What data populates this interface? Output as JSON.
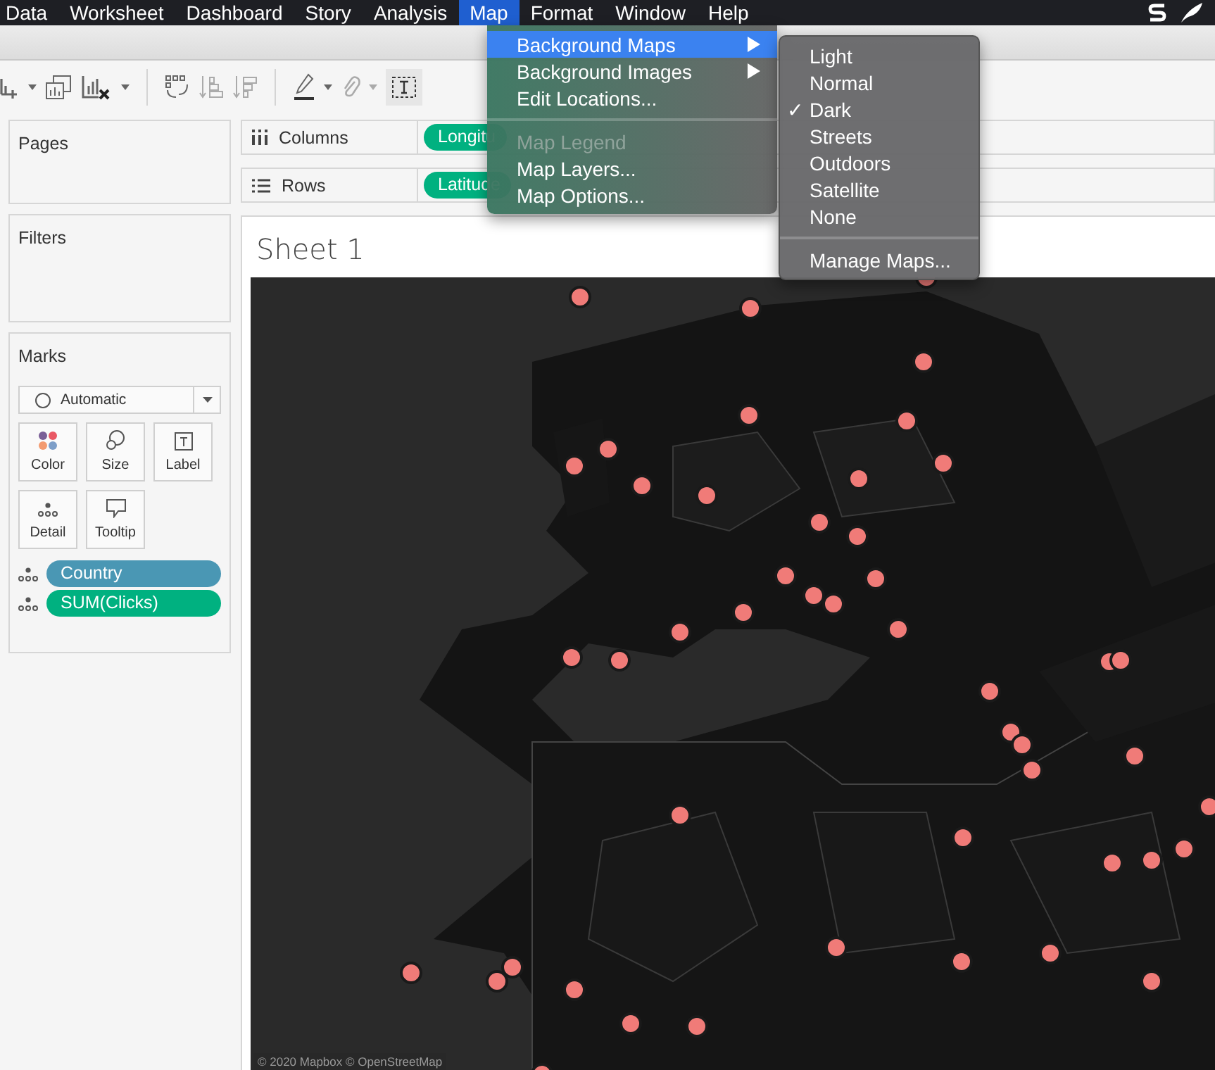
{
  "menubar": {
    "items": [
      {
        "label": "Data",
        "selected": false
      },
      {
        "label": "Worksheet",
        "selected": false
      },
      {
        "label": "Dashboard",
        "selected": false
      },
      {
        "label": "Story",
        "selected": false
      },
      {
        "label": "Analysis",
        "selected": false
      },
      {
        "label": "Map",
        "selected": true
      },
      {
        "label": "Format",
        "selected": false
      },
      {
        "label": "Window",
        "selected": false
      },
      {
        "label": "Help",
        "selected": false
      }
    ]
  },
  "map_menu": {
    "items": [
      {
        "kind": "item",
        "label": "Background Maps",
        "submenu": true,
        "disabled": false,
        "selected": true
      },
      {
        "kind": "item",
        "label": "Background Images",
        "submenu": true,
        "disabled": false,
        "selected": false
      },
      {
        "kind": "item",
        "label": "Edit Locations...",
        "submenu": false,
        "disabled": false,
        "selected": false
      },
      {
        "kind": "separator"
      },
      {
        "kind": "item",
        "label": "Map Legend",
        "submenu": false,
        "disabled": true,
        "selected": false
      },
      {
        "kind": "item",
        "label": "Map Layers...",
        "submenu": false,
        "disabled": false,
        "selected": false
      },
      {
        "kind": "item",
        "label": "Map Options...",
        "submenu": false,
        "disabled": false,
        "selected": false
      }
    ]
  },
  "background_maps_menu": {
    "items": [
      {
        "kind": "item",
        "label": "Light",
        "checked": false
      },
      {
        "kind": "item",
        "label": "Normal",
        "checked": false
      },
      {
        "kind": "item",
        "label": "Dark",
        "checked": true
      },
      {
        "kind": "item",
        "label": "Streets",
        "checked": false
      },
      {
        "kind": "item",
        "label": "Outdoors",
        "checked": false
      },
      {
        "kind": "item",
        "label": "Satellite",
        "checked": false
      },
      {
        "kind": "item",
        "label": "None",
        "checked": false
      },
      {
        "kind": "separator"
      },
      {
        "kind": "item",
        "label": "Manage Maps...",
        "checked": false
      }
    ]
  },
  "check_mark": "✓",
  "pages_card": {
    "title": "Pages"
  },
  "filters_card": {
    "title": "Filters"
  },
  "marks_card": {
    "title": "Marks",
    "mark_type": "Automatic",
    "buttons": [
      {
        "kind": "color",
        "label": "Color"
      },
      {
        "kind": "size",
        "label": "Size"
      },
      {
        "kind": "label",
        "label": "Label"
      },
      {
        "kind": "detail",
        "label": "Detail"
      },
      {
        "kind": "tooltip",
        "label": "Tooltip"
      }
    ],
    "fields": [
      {
        "label": "Country",
        "color": "#4a97b4"
      },
      {
        "label": "SUM(Clicks)",
        "color": "#00b180"
      }
    ]
  },
  "shelves": [
    {
      "kind": "columns",
      "title": "Columns",
      "pill": "Longitu"
    },
    {
      "kind": "rows",
      "title": "Rows",
      "pill": "Latitude"
    }
  ],
  "sheet": {
    "title": "Sheet 1",
    "attribution": "© 2020 Mapbox © OpenStreetMap"
  }
}
